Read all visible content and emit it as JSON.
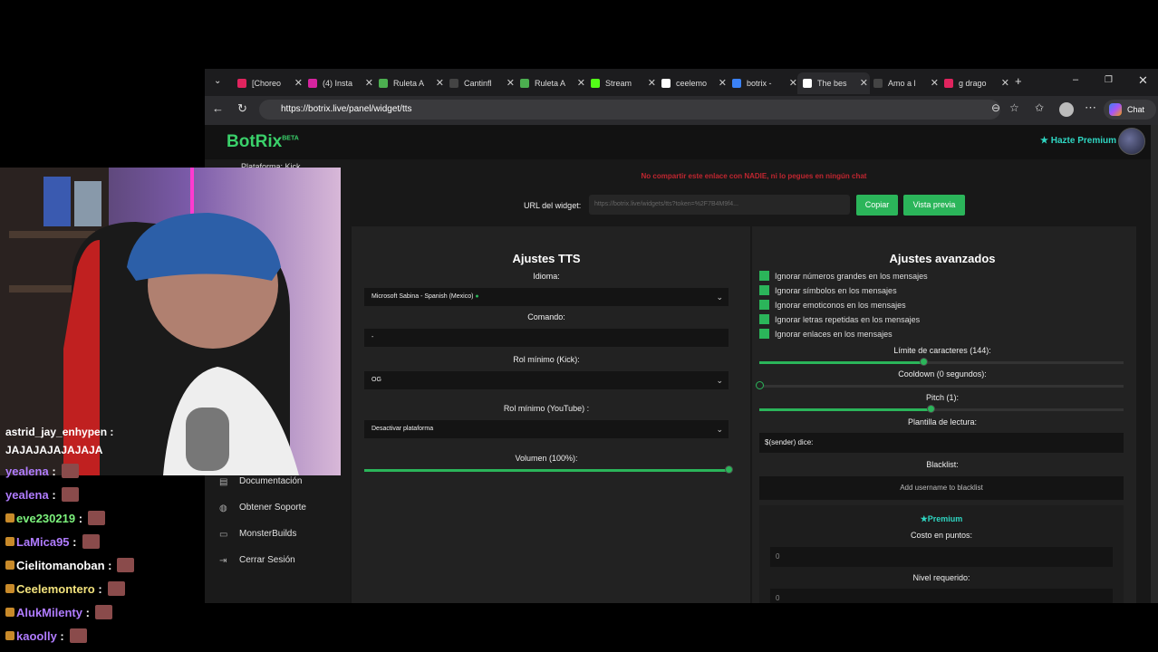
{
  "browser": {
    "tabs": [
      {
        "label": "[Choreo",
        "color": "#e0245e"
      },
      {
        "label": "(4) Insta",
        "color": "#d6249f"
      },
      {
        "label": "Ruleta A",
        "color": "#4caf50"
      },
      {
        "label": "Cantinfl",
        "color": "#444444"
      },
      {
        "label": "Ruleta A",
        "color": "#4caf50"
      },
      {
        "label": "Stream",
        "color": "#53fc18"
      },
      {
        "label": "ceelemo",
        "color": "#ffffff"
      },
      {
        "label": "botrix -",
        "color": "#3b82f6"
      },
      {
        "label": "The bes",
        "color": "#ffffff"
      },
      {
        "label": "Amo a l",
        "color": "#444444"
      },
      {
        "label": "g drago",
        "color": "#e0245e"
      }
    ],
    "url": "https://botrix.live/panel/widget/tts",
    "chat_button": "Chat"
  },
  "site": {
    "logo": "BotRix",
    "logo_beta": "BETA",
    "premium_link": "Hazte Premium",
    "platform_label": "Plataforma: Kick"
  },
  "sidebar": {
    "items": [
      {
        "label": "Documentación",
        "icon": "book-icon"
      },
      {
        "label": "Obtener Soporte",
        "icon": "support-icon"
      },
      {
        "label": "MonsterBuilds",
        "icon": "laptop-icon"
      },
      {
        "label": "Cerrar Sesión",
        "icon": "logout-icon"
      }
    ]
  },
  "widget": {
    "warning": "No compartir este enlace con NADIE, ni lo pegues en ningún chat",
    "url_label": "URL del widget:",
    "url_value": "https://botrix.live/widgets/tts?token=%2F7B4M9f4...",
    "copy_button": "Copiar",
    "preview_button": "Vista previa"
  },
  "tts": {
    "title": "Ajustes TTS",
    "language_label": "Idioma:",
    "language_value": "Microsoft Sabina - Spanish (Mexico)",
    "command_label": "Comando:",
    "command_value": "-",
    "role_kick_label": "Rol mínimo (Kick):",
    "role_kick_value": "OG",
    "role_youtube_label": "Rol mínimo (YouTube) :",
    "role_youtube_value": "Desactivar plataforma",
    "volume_label": "Volumen (100%):",
    "volume_percent": 100
  },
  "advanced": {
    "title": "Ajustes avanzados",
    "checks": [
      "Ignorar números grandes en los mensajes",
      "Ignorar símbolos en los mensajes",
      "Ignorar emoticonos en los mensajes",
      "Ignorar letras repetidas en los mensajes",
      "Ignorar enlaces en los mensajes"
    ],
    "char_limit_label": "Límite de caracteres (144):",
    "char_limit_fraction": 0.45,
    "cooldown_label": "Cooldown (0 segundos):",
    "cooldown_fraction": 0,
    "pitch_label": "Pitch (1):",
    "pitch_fraction": 0.47,
    "template_label": "Plantilla de lectura:",
    "template_value": "$(sender) dice:",
    "blacklist_label": "Blacklist:",
    "blacklist_button": "Add username to blacklist",
    "premium_title": "Premium",
    "cost_label": "Costo en puntos:",
    "cost_value": "0",
    "level_label": "Nivel requerido:",
    "level_value": "0"
  },
  "chat": {
    "messages": [
      {
        "user": "astrid_jay_enhypen",
        "text": "JAJAJAJAJAJAJA",
        "color": "#ffffff"
      },
      {
        "user": "yealena",
        "color": "#b07cff"
      },
      {
        "user": "yealena",
        "color": "#b07cff"
      },
      {
        "user": "eve230219",
        "color": "#7cf27c"
      },
      {
        "user": "LaMica95",
        "color": "#b07cff"
      },
      {
        "user": "Cielitomanoban",
        "color": "#ffffff"
      },
      {
        "user": "Ceelemontero",
        "color": "#f2e27c"
      },
      {
        "user": "AlukMilenty",
        "color": "#b07cff"
      },
      {
        "user": "kaoolly",
        "color": "#b07cff"
      }
    ]
  }
}
